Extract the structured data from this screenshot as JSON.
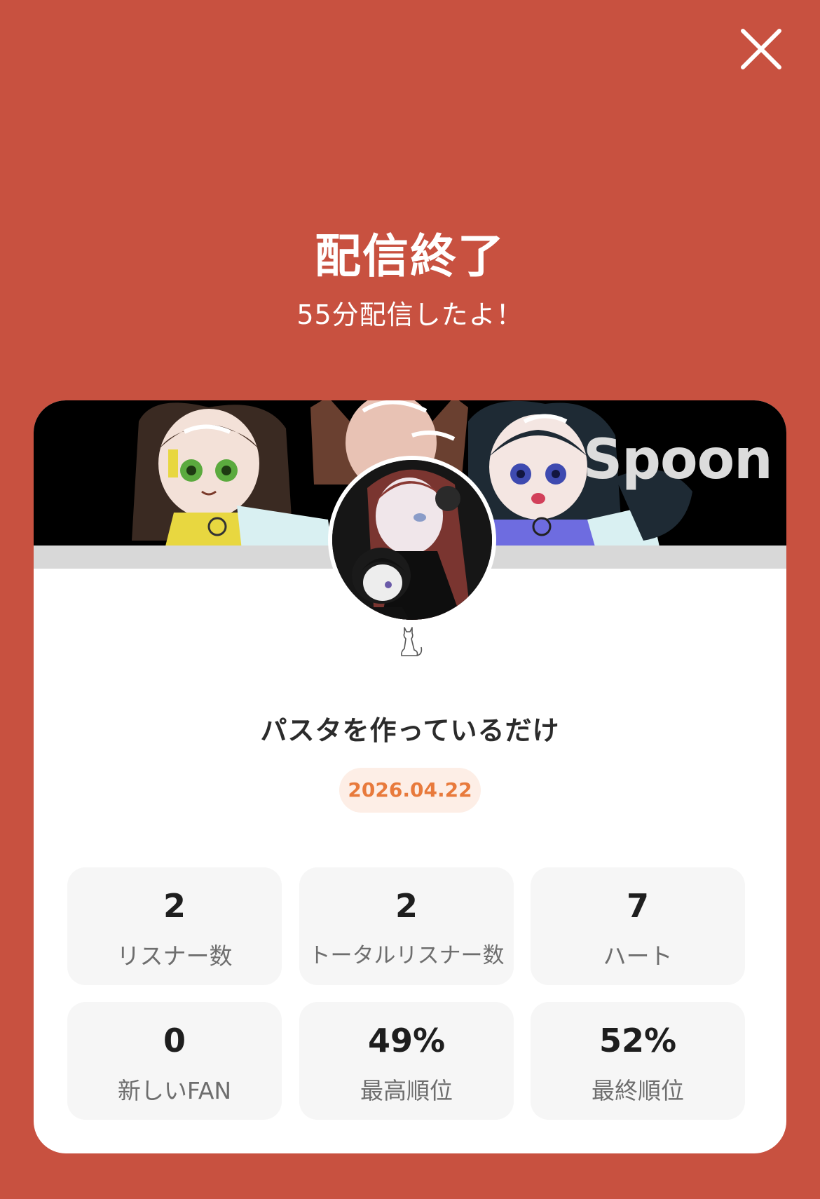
{
  "header": {
    "title": "配信終了",
    "subtitle": "55分配信したよ！"
  },
  "close_icon": "close-icon",
  "banner": {
    "logo_text": "Spoon"
  },
  "room": {
    "title": "パスタを作っているだけ",
    "date": "2026.04.22"
  },
  "colors": {
    "background": "#C85140",
    "date_text": "#E87A3C",
    "date_bg": "#FDEEE6"
  },
  "stats": [
    {
      "value": "2",
      "label": "リスナー数"
    },
    {
      "value": "2",
      "label": "トータルリスナー数"
    },
    {
      "value": "7",
      "label": "ハート"
    },
    {
      "value": "0",
      "label": "新しいFAN"
    },
    {
      "value": "49%",
      "label": "最高順位"
    },
    {
      "value": "52%",
      "label": "最終順位"
    }
  ]
}
